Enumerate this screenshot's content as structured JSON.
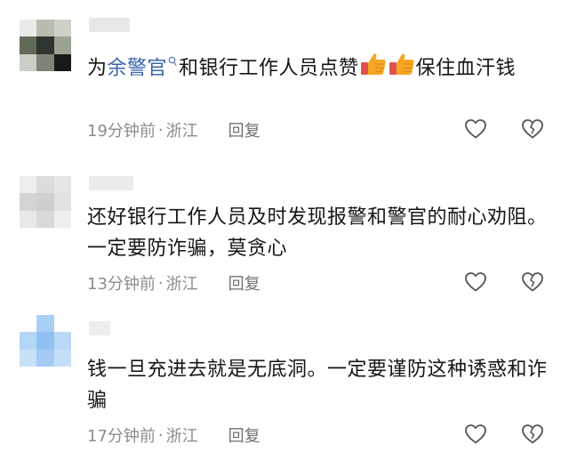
{
  "comments": [
    {
      "text_prefix": "为",
      "mention": "余警官",
      "text_mid": "和银行工作人员点赞",
      "text_after": "保住血汗钱",
      "time": "19分钟前",
      "dot": "·",
      "location": "浙江",
      "reply_label": "回复"
    },
    {
      "text": "还好银行工作人员及时发现报警和警官的耐心劝阻。一定要防诈骗，莫贪心",
      "time": "13分钟前",
      "dot": "·",
      "location": "浙江",
      "reply_label": "回复"
    },
    {
      "text": "钱一旦充进去就是无底洞。一定要谨防这种诱惑和诈骗",
      "time": "17分钟前",
      "dot": "·",
      "location": "浙江",
      "reply_label": "回复"
    }
  ],
  "icons": {
    "like": "heart-outline-icon",
    "dislike": "broken-heart-icon",
    "emoji": "thumbs-up-emoji-icon",
    "mention": "search-icon"
  },
  "colors": {
    "mention": "#3a64a8",
    "meta": "#8c8c8c",
    "emoji": "#f5a623",
    "emoji_sleeve": "#e0524d"
  }
}
